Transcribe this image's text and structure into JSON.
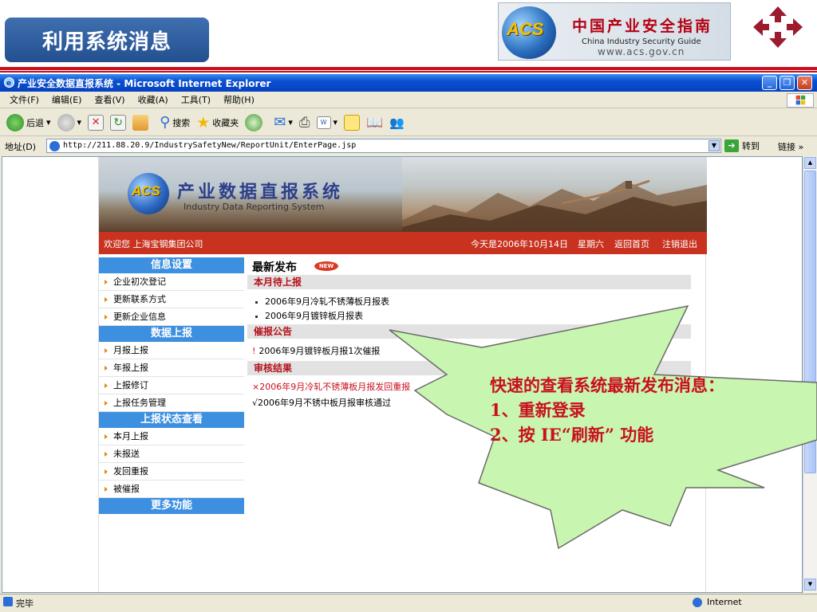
{
  "slide": {
    "title": "利用系统消息",
    "logo_brand": "ACS",
    "logo_title_cn": "中国产业安全指南",
    "logo_title_en": "China  Industry  Security  Guide",
    "logo_url": "www.acs.gov.cn"
  },
  "browser": {
    "window_title": "产业安全数据直报系统 - Microsoft Internet Explorer",
    "menu": [
      "文件(F)",
      "编辑(E)",
      "查看(V)",
      "收藏(A)",
      "工具(T)",
      "帮助(H)"
    ],
    "toolbar": {
      "back": "后退",
      "search": "搜索",
      "favorites": "收藏夹"
    },
    "address_label": "地址(D)",
    "address": "http://211.88.20.9/IndustrySafetyNew/ReportUnit/EnterPage.jsp",
    "go_label": "转到",
    "links_label": "链接",
    "status": "完毕",
    "zone": "Internet"
  },
  "site": {
    "logo_brand": "ACS",
    "title": "产业数据直报系统",
    "subtitle": "Industry  Data  Reporting  System",
    "welcome": "欢迎您 上海宝钢集团公司",
    "date": "今天是2006年10月14日",
    "weekday": "星期六",
    "home": "返回首页",
    "logout": "注销退出",
    "sidebar": {
      "info_head": "信息设置",
      "info_items": [
        "企业初次登记",
        "更新联系方式",
        "更新企业信息"
      ],
      "data_head": "数据上报",
      "data_items": [
        "月报上报",
        "年报上报",
        "上报修订",
        "上报任务管理"
      ],
      "status_head": "上报状态查看",
      "status_items": [
        "本月上报",
        "未报送",
        "发回重报",
        "被催报"
      ],
      "more_head": "更多功能"
    },
    "main": {
      "latest": "最新发布",
      "new_badge": "NEW",
      "pending_head": "本月待上报",
      "pending_items": [
        "2006年9月冷轧不锈薄板月报表",
        "2006年9月镀锌板月报表"
      ],
      "urge_head": "催报公告",
      "urge_items": [
        "2006年9月镀锌板月报1次催报"
      ],
      "review_head": "审核结果",
      "review_items": [
        "×2006年9月冷轧不锈薄板月报发回重报",
        "√2006年9月不锈中板月报审核通过"
      ]
    }
  },
  "callout": {
    "line1": "快速的查看系统最新发布消息：",
    "line2": "1、重新登录",
    "line3": "2、按 IE“刷新” 功能"
  },
  "colors": {
    "accent_red": "#c8101e",
    "nav_blue": "#3d8fe0",
    "title_blue": "#23508f",
    "callout_green": "#c8f5b0"
  }
}
